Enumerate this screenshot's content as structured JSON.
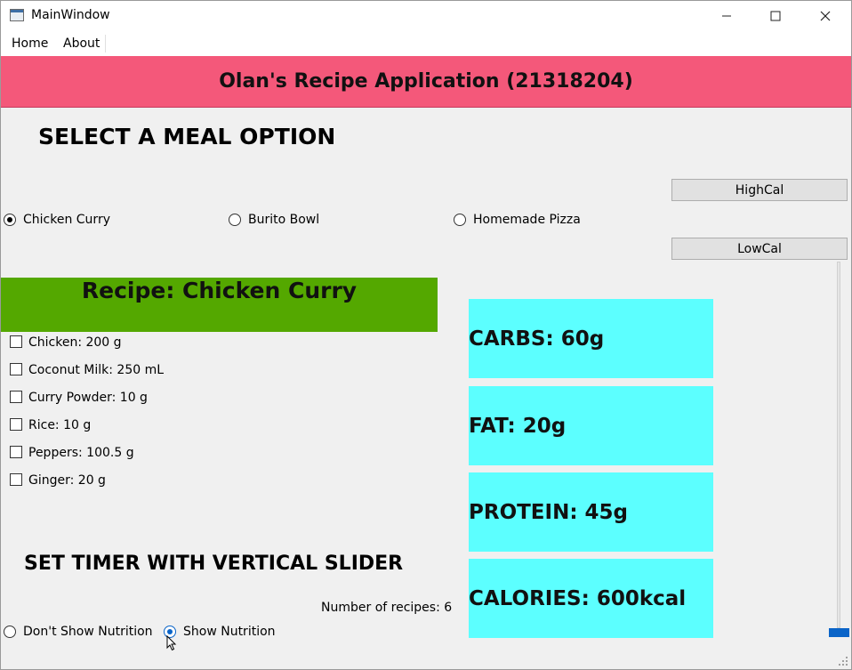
{
  "window": {
    "title": "MainWindow",
    "controls": {
      "minimize": "—",
      "maximize": "☐",
      "close": "✕"
    }
  },
  "menu": {
    "items": [
      "Home",
      "About"
    ]
  },
  "header": {
    "title": "Olan's Recipe Application (21318204)"
  },
  "meal_select": {
    "heading": "SELECT A MEAL OPTION",
    "options": [
      {
        "label": "Chicken Curry",
        "checked": true
      },
      {
        "label": "Burito Bowl",
        "checked": false
      },
      {
        "label": "Homemade Pizza",
        "checked": false
      }
    ]
  },
  "buttons": {
    "high_cal": "HighCal",
    "low_cal": "LowCal"
  },
  "recipe": {
    "title": "Recipe: Chicken Curry",
    "ingredients": [
      "Chicken: 200 g",
      "Coconut Milk: 250 mL",
      "Curry Powder: 10 g",
      "Rice: 10 g",
      "Peppers: 100.5 g",
      "Ginger: 20 g"
    ]
  },
  "nutrition": {
    "carbs": "CARBS: 60g",
    "fat": "FAT: 20g",
    "protein": "PROTEIN: 45g",
    "calories": "CALORIES: 600kcal"
  },
  "timer": {
    "heading": "SET TIMER WITH VERTICAL SLIDER",
    "slider_value": 0
  },
  "recipe_count": "Number of recipes: 6",
  "nutrition_toggle": {
    "options": [
      {
        "label": "Don't Show Nutrition",
        "checked": false
      },
      {
        "label": "Show Nutrition",
        "checked": true
      }
    ]
  },
  "colors": {
    "header_bg": "#f4587a",
    "recipe_bg": "#54a800",
    "nutrition_bg": "#5cffff",
    "accent": "#0a64c8"
  }
}
